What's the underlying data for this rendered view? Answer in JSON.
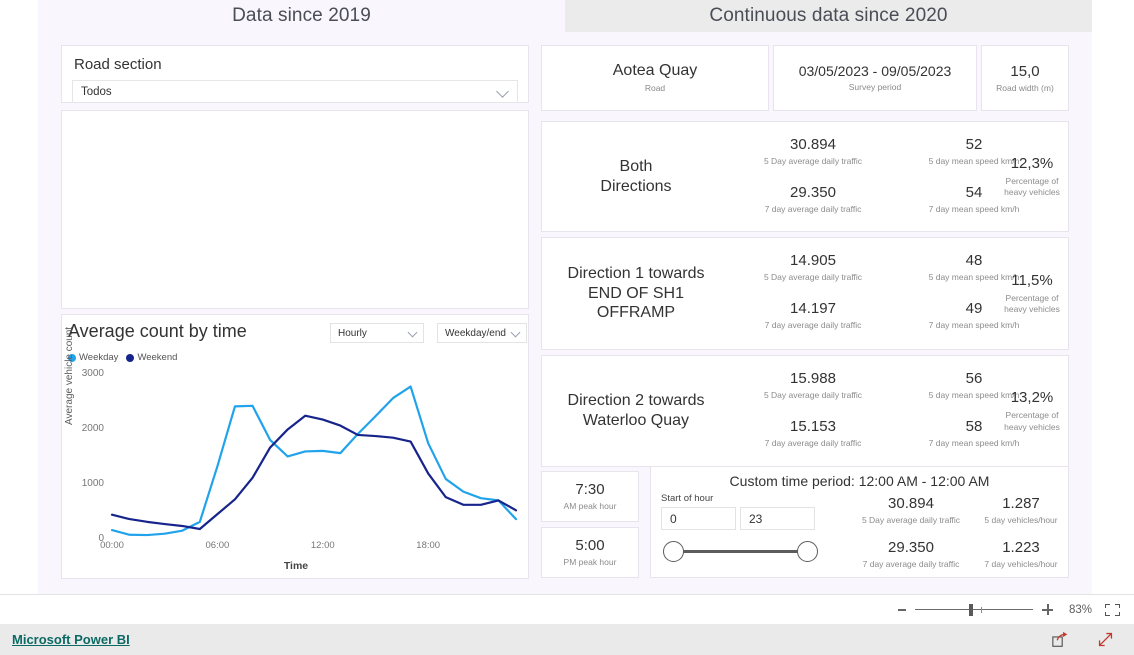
{
  "header": {
    "left_tab": "Data since 2019",
    "right_tab": "Continuous data since 2020"
  },
  "slicer": {
    "title": "Road section",
    "value": "Todos",
    "chevron_icon": "chevron-down-icon"
  },
  "chart_panel": {
    "title": "Average count by time",
    "granularity_dropdown": "Hourly",
    "daytype_dropdown": "Weekday/end"
  },
  "chart_data": {
    "type": "line",
    "title": "Average count by time",
    "xlabel": "Time",
    "ylabel": "Average vehicle count",
    "ylim": [
      0,
      3000
    ],
    "yticks": [
      0,
      1000,
      2000,
      3000
    ],
    "xticks": [
      "00:00",
      "06:00",
      "12:00",
      "18:00"
    ],
    "grid": false,
    "legend_position": "top-left",
    "x": [
      0,
      1,
      2,
      3,
      4,
      5,
      6,
      7,
      8,
      9,
      10,
      11,
      12,
      13,
      14,
      15,
      16,
      17,
      18,
      19,
      20,
      21,
      22,
      23
    ],
    "series": [
      {
        "name": "Weekday",
        "color": "#21A3EB",
        "values": [
          180,
          95,
          90,
          115,
          170,
          330,
          1340,
          2430,
          2440,
          1820,
          1520,
          1610,
          1620,
          1580,
          1930,
          2250,
          2580,
          2790,
          1760,
          1110,
          880,
          760,
          720,
          380
        ]
      },
      {
        "name": "Weekend",
        "color": "#17248C",
        "values": [
          460,
          380,
          330,
          290,
          255,
          200,
          470,
          740,
          1130,
          1680,
          2010,
          2260,
          2190,
          2080,
          1910,
          1890,
          1860,
          1790,
          1210,
          780,
          640,
          640,
          720,
          540
        ]
      }
    ],
    "legend": [
      "Weekday",
      "Weekend"
    ]
  },
  "info_cards": [
    {
      "value": "Aotea Quay",
      "label": "Road"
    },
    {
      "value": "03/05/2023 - 09/05/2023",
      "label": "Survey period"
    },
    {
      "value": "15,0",
      "label": "Road width (m)"
    }
  ],
  "directions": [
    {
      "name": "Both\nDirections",
      "name_lines": [
        "Both",
        "Directions"
      ],
      "adt_5day": "30.894",
      "adt_5day_label": "5 Day average daily traffic",
      "speed_5day": "52",
      "speed_5day_label": "5 day mean speed km/h",
      "adt_7day": "29.350",
      "adt_7day_label": "7 day average daily traffic",
      "speed_7day": "54",
      "speed_7day_label": "7 day mean speed km/h",
      "heavy_pct": "12,3%",
      "heavy_pct_label": "Percentage of heavy vehicles"
    },
    {
      "name": "Direction 1 towards END OF SH1 OFFRAMP",
      "name_lines": [
        "Direction 1 towards",
        "END OF SH1",
        "OFFRAMP"
      ],
      "adt_5day": "14.905",
      "adt_5day_label": "5 Day average daily traffic",
      "speed_5day": "48",
      "speed_5day_label": "5 day mean speed km/h",
      "adt_7day": "14.197",
      "adt_7day_label": "7 day average daily traffic",
      "speed_7day": "49",
      "speed_7day_label": "7 day mean speed km/h",
      "heavy_pct": "11,5%",
      "heavy_pct_label": "Percentage of heavy vehicles"
    },
    {
      "name": "Direction 2 towards Waterloo Quay",
      "name_lines": [
        "Direction 2 towards",
        "Waterloo Quay"
      ],
      "adt_5day": "15.988",
      "adt_5day_label": "5 Day average daily traffic",
      "speed_5day": "56",
      "speed_5day_label": "5 day mean speed km/h",
      "adt_7day": "15.153",
      "adt_7day_label": "7 day average daily traffic",
      "speed_7day": "58",
      "speed_7day_label": "7 day mean speed km/h",
      "heavy_pct": "13,2%",
      "heavy_pct_label": "Percentage of heavy vehicles"
    }
  ],
  "peak_hours": [
    {
      "value": "7:30",
      "label": "AM peak hour"
    },
    {
      "value": "5:00",
      "label": "PM peak hour"
    }
  ],
  "custom_period": {
    "title": "Custom time period: 12:00 AM - 12:00 AM",
    "start_of_hour_label": "Start of hour",
    "start_value": "0",
    "end_value": "23",
    "adt_5day": "30.894",
    "adt_5day_label": "5 Day average daily traffic",
    "vph_5day": "1.287",
    "vph_5day_label": "5 day vehicles/hour",
    "adt_7day": "29.350",
    "adt_7day_label": "7 day average daily traffic",
    "vph_7day": "1.223",
    "vph_7day_label": "7 day vehicles/hour"
  },
  "statusbar": {
    "zoom_out_icon": "minus-icon",
    "zoom_in_icon": "plus-icon",
    "zoom_level": "83%",
    "fit_icon": "fit-to-page-icon"
  },
  "footer": {
    "brand": "Microsoft Power BI",
    "share_icon": "share-icon",
    "fullscreen_icon": "fullscreen-icon"
  },
  "colors": {
    "canvas_bg": "#f9f6fd",
    "tab_active_bg": "#ebebeb",
    "weekday": "#21A3EB",
    "weekend": "#17248C",
    "link": "#0b6a63"
  }
}
